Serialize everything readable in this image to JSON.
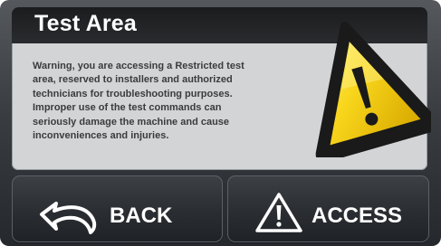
{
  "dialog": {
    "title": "Test Area",
    "warning_lines": [
      "Warning, you are accessing a Restricted test",
      "area, reserved to installers and authorized",
      "technicians for troubleshooting purposes.",
      "Improper use of the test commands can",
      "seriously damage the machine and cause",
      "inconveniences and injuries."
    ],
    "warning_icon": "warning-triangle-icon"
  },
  "buttons": {
    "back": {
      "label": "BACK",
      "icon": "back-arrow-icon"
    },
    "access": {
      "label": "ACCESS",
      "icon": "warning-outline-icon"
    }
  },
  "colors": {
    "panel_background": "#d2d4d6",
    "title_bar": "#1b1c1e",
    "warning_yellow": "#f5d31e",
    "button_background": "#2a2d31",
    "text_dark": "#3a3b3d"
  }
}
